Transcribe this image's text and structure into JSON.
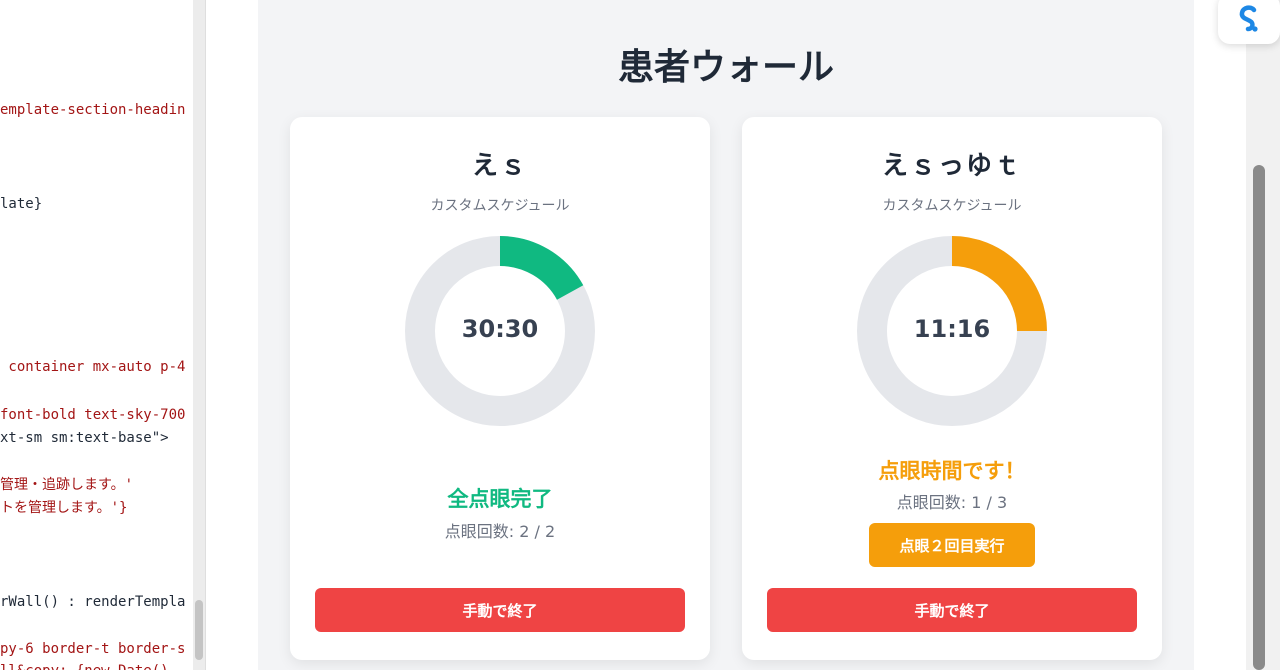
{
  "code_lines": [
    {
      "text": "emplate-section-headin",
      "dark": false
    },
    {
      "text": "late}",
      "dark": true
    },
    {
      "text": " container mx-auto p-4",
      "dark": false
    },
    {
      "text": "font-bold text-sky-700",
      "dark": false
    },
    {
      "text": "xt-sm sm:text-base\">",
      "dark": false
    },
    {
      "text": "管理・追跡します。'",
      "dark": false
    },
    {
      "text": "トを管理します。'}",
      "dark": false
    },
    {
      "text": "rWall() : renderTempla",
      "dark": true
    },
    {
      "text": "py-6 border-t border-s",
      "dark": false
    },
    {
      "text": "ll&copy; {new Date() ",
      "dark": false
    }
  ],
  "wall": {
    "title": "患者ウォール"
  },
  "cards": [
    {
      "name": "えｓ",
      "schedule": "カスタムスケジュール",
      "timer": "30:30",
      "progress": 0.17,
      "ring_color": "#10b981",
      "status": "全点眼完了",
      "status_color": "#10b981",
      "count": "点眼回数: 2 / 2",
      "action_label": "",
      "end_label": "手動で終了"
    },
    {
      "name": "えｓっゆｔ",
      "schedule": "カスタムスケジュール",
      "timer": "11:16",
      "progress": 0.25,
      "ring_color": "#f59e0b",
      "status": "点眼時間です！",
      "status_color": "#f59e0b",
      "count": "点眼回数: 1 / 3",
      "action_label": "点眼２回目実行",
      "end_label": "手動で終了"
    }
  ],
  "colors": {
    "ring_track": "#e5e7eb",
    "end_button": "#ef4444",
    "action_button": "#f59e0b"
  },
  "icons": {
    "extension": "extension-icon"
  }
}
